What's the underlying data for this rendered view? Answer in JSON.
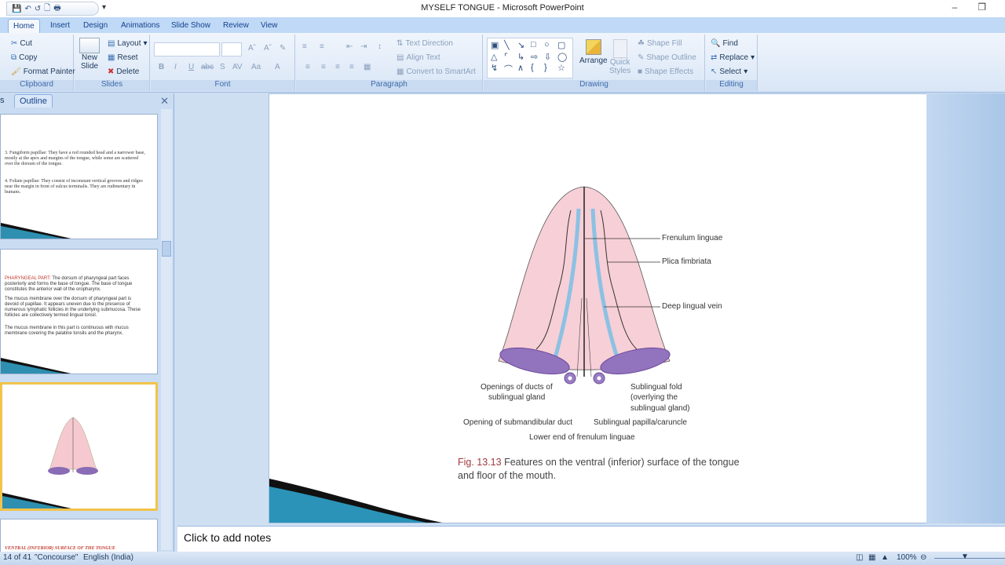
{
  "window": {
    "title": "MYSELF TONGUE - Microsoft PowerPoint",
    "minimize_icon": "minimize-icon",
    "restore_icon": "restore-icon"
  },
  "quick_access": [
    "save-icon",
    "undo-icon",
    "redo-icon",
    "new-icon",
    "print-preview-icon"
  ],
  "tabs": [
    {
      "label": "Home",
      "active": true
    },
    {
      "label": "Insert"
    },
    {
      "label": "Design"
    },
    {
      "label": "Animations"
    },
    {
      "label": "Slide Show"
    },
    {
      "label": "Review"
    },
    {
      "label": "View"
    }
  ],
  "ribbon": {
    "clipboard": {
      "label": "Clipboard",
      "cut": "Cut",
      "copy": "Copy",
      "format_painter": "Format Painter"
    },
    "slides": {
      "label": "Slides",
      "new_slide_1": "New",
      "new_slide_2": "Slide",
      "layout": "Layout",
      "reset": "Reset",
      "delete": "Delete"
    },
    "font": {
      "label": "Font",
      "font_name": "",
      "font_size": ""
    },
    "paragraph": {
      "label": "Paragraph",
      "text_direction": "Text Direction",
      "align_text": "Align Text",
      "convert_smartart": "Convert to SmartArt"
    },
    "drawing": {
      "label": "Drawing",
      "arrange": "Arrange",
      "quick_styles_1": "Quick",
      "quick_styles_2": "Styles",
      "shape_fill": "Shape Fill",
      "shape_outline": "Shape Outline",
      "shape_effects": "Shape Effects"
    },
    "editing": {
      "label": "Editing",
      "find": "Find",
      "replace": "Replace",
      "select": "Select"
    }
  },
  "left_panel": {
    "tab_slides": "s",
    "tab_outline": "Outline",
    "slides": [
      {
        "text": [
          "3. Fungiform papillae: They have a red rounded head and a narrower base, mostly at the apex and margins of the tongue, while some are scattered over the dorsum of the tongue.",
          "4. Foliate papillae: They consist of inconstant vertical grooves and ridges near the margin in front of sulcus terminalis. They are rudimentary in humans."
        ]
      },
      {
        "heading": "PHARYNGEAL PART:",
        "text": [
          "The dorsum of pharyngeal part faces posteriorly and forms the base of tongue. The base of tongue constitutes the anterior wall of the oropharynx.",
          "The mucus membrane over the dorsum of pharyngeal part is devoid of papillae. It appears uneven due to the presence of numerous lymphatic follicles in the underlying submucosa. These follicles are collectively termed lingual tonsil.",
          "The mucus membrane in this part is continuous with mucus membrane covering the palatine tonsils and the pharynx."
        ]
      },
      {
        "selected": true,
        "thumb": "tongue-diagram-thumbnail"
      },
      {
        "heading": "VENTRAL (INFERIOR) SURFACE OF THE TONGUE"
      }
    ]
  },
  "slide": {
    "labels": {
      "frenulum": "Frenulum linguae",
      "plica": "Plica fimbriata",
      "deep_vein": "Deep lingual vein",
      "ducts_1": "Openings of ducts of",
      "ducts_2": "sublingual gland",
      "fold_1": "Sublingual fold",
      "fold_2": "(overlying the",
      "fold_3": "sublingual gland)",
      "submandibular": "Opening of submandibular duct",
      "papilla": "Sublingual papilla/caruncle",
      "lower_end": "Lower end of frenulum linguae"
    },
    "caption_fig": "Fig. 13.13",
    "caption_text": " Features on the ventral (inferior) surface of the tongue and floor of the mouth."
  },
  "notes_placeholder": "Click to add notes",
  "status": {
    "slide_count": "14 of 41",
    "theme": "\"Concourse\"",
    "language": "English (India)",
    "zoom": "100%"
  }
}
